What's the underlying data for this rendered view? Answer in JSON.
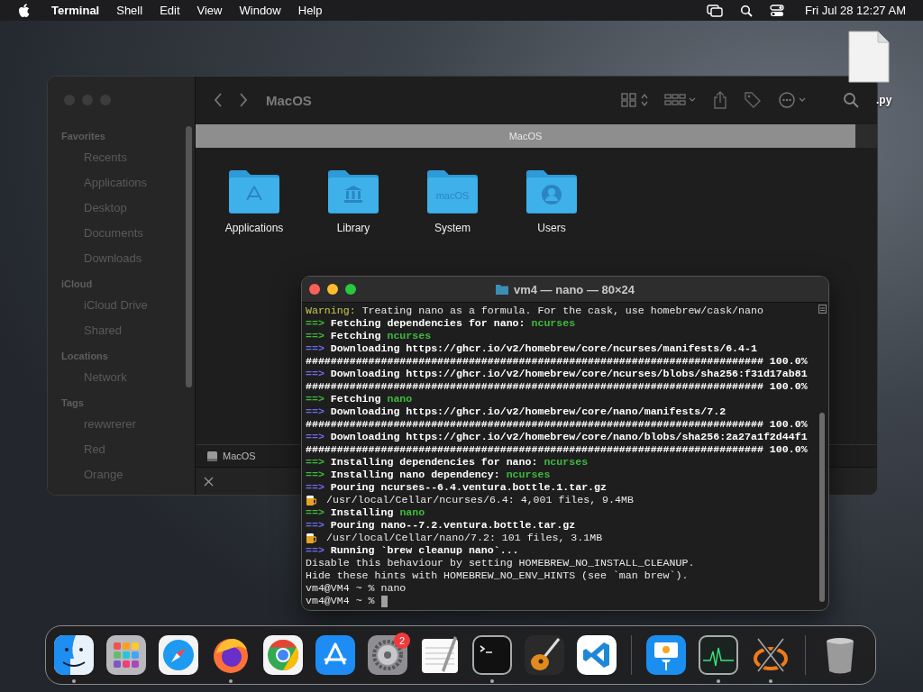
{
  "menu_bar": {
    "app": "Terminal",
    "menus": [
      "Shell",
      "Edit",
      "View",
      "Window",
      "Help"
    ],
    "clock": "Fri Jul 28  12:27 AM"
  },
  "desktop_file": {
    "label": ".py"
  },
  "finder": {
    "title": "MacOS",
    "path_tab": "MacOS",
    "sidebar": [
      {
        "heading": "Favorites",
        "items": [
          "Recents",
          "Applications",
          "Desktop",
          "Documents",
          "Downloads"
        ]
      },
      {
        "heading": "iCloud",
        "items": [
          "iCloud Drive",
          "Shared"
        ]
      },
      {
        "heading": "Locations",
        "items": [
          "Network"
        ]
      },
      {
        "heading": "Tags",
        "items": [
          "rewwrerer",
          "Red",
          "Orange"
        ]
      }
    ],
    "folders": [
      {
        "name": "Applications",
        "kind": "apps"
      },
      {
        "name": "Library",
        "kind": "library"
      },
      {
        "name": "System",
        "kind": "system",
        "mark": "macOS"
      },
      {
        "name": "Users",
        "kind": "users"
      }
    ],
    "path_bar": "MacOS"
  },
  "terminal": {
    "title": "vm4 — nano — 80×24",
    "lines": [
      {
        "kind": "text",
        "segments": [
          {
            "kind": "warning",
            "text": "Warning:"
          },
          {
            "kind": "output",
            "text": " Treating nano as a formula. For the cask, use homebrew/cask/nano"
          }
        ]
      },
      {
        "kind": "text",
        "segments": [
          {
            "kind": "arrow",
            "color": "#3dbb3d",
            "text": "==>"
          },
          {
            "kind": "command",
            "text": " Fetching dependencies for nano: "
          },
          {
            "kind": "package",
            "text": "ncurses"
          }
        ]
      },
      {
        "kind": "text",
        "segments": [
          {
            "kind": "arrow",
            "color": "#3dbb3d",
            "text": "==>"
          },
          {
            "kind": "command",
            "text": " Fetching "
          },
          {
            "kind": "package",
            "text": "ncurses"
          }
        ]
      },
      {
        "kind": "text",
        "segments": [
          {
            "kind": "arrow",
            "color": "#6d6df0",
            "text": "==>"
          },
          {
            "kind": "command",
            "text": " Downloading https://ghcr.io/v2/homebrew/core/ncurses/manifests/6.4-1"
          }
        ]
      },
      {
        "kind": "text",
        "segments": [
          {
            "kind": "command",
            "text": "######################################################################### 100.0%"
          }
        ]
      },
      {
        "kind": "text",
        "segments": [
          {
            "kind": "arrow",
            "color": "#6d6df0",
            "text": "==>"
          },
          {
            "kind": "command",
            "text": " Downloading https://ghcr.io/v2/homebrew/core/ncurses/blobs/sha256:f31d17ab81"
          }
        ]
      },
      {
        "kind": "text",
        "segments": [
          {
            "kind": "command",
            "text": "######################################################################### 100.0%"
          }
        ]
      },
      {
        "kind": "text",
        "segments": [
          {
            "kind": "arrow",
            "color": "#3dbb3d",
            "text": "==>"
          },
          {
            "kind": "command",
            "text": " Fetching "
          },
          {
            "kind": "package",
            "text": "nano"
          }
        ]
      },
      {
        "kind": "text",
        "segments": [
          {
            "kind": "arrow",
            "color": "#6d6df0",
            "text": "==>"
          },
          {
            "kind": "command",
            "text": " Downloading https://ghcr.io/v2/homebrew/core/nano/manifests/7.2"
          }
        ]
      },
      {
        "kind": "text",
        "segments": [
          {
            "kind": "command",
            "text": "######################################################################### 100.0%"
          }
        ]
      },
      {
        "kind": "text",
        "segments": [
          {
            "kind": "arrow",
            "color": "#6d6df0",
            "text": "==>"
          },
          {
            "kind": "command",
            "text": " Downloading https://ghcr.io/v2/homebrew/core/nano/blobs/sha256:2a27a1f2d44f1"
          }
        ]
      },
      {
        "kind": "text",
        "segments": [
          {
            "kind": "command",
            "text": "######################################################################### 100.0%"
          }
        ]
      },
      {
        "kind": "text",
        "segments": [
          {
            "kind": "arrow",
            "color": "#3dbb3d",
            "text": "==>"
          },
          {
            "kind": "command",
            "text": " Installing dependencies for nano: "
          },
          {
            "kind": "package",
            "text": "ncurses"
          }
        ]
      },
      {
        "kind": "text",
        "segments": [
          {
            "kind": "arrow",
            "color": "#3dbb3d",
            "text": "==>"
          },
          {
            "kind": "command",
            "text": " Installing nano dependency: "
          },
          {
            "kind": "package",
            "text": "ncurses"
          }
        ]
      },
      {
        "kind": "text",
        "segments": [
          {
            "kind": "arrow",
            "color": "#6d6df0",
            "text": "==>"
          },
          {
            "kind": "command",
            "text": " Pouring ncurses--6.4.ventura.bottle.1.tar.gz"
          }
        ]
      },
      {
        "kind": "beer",
        "segments": [
          {
            "kind": "output",
            "text": "/usr/local/Cellar/ncurses/6.4: 4,001 files, 9.4MB"
          }
        ]
      },
      {
        "kind": "text",
        "segments": [
          {
            "kind": "arrow",
            "color": "#3dbb3d",
            "text": "==>"
          },
          {
            "kind": "command",
            "text": " Installing "
          },
          {
            "kind": "package",
            "text": "nano"
          }
        ]
      },
      {
        "kind": "text",
        "segments": [
          {
            "kind": "arrow",
            "color": "#6d6df0",
            "text": "==>"
          },
          {
            "kind": "command",
            "text": " Pouring nano--7.2.ventura.bottle.tar.gz"
          }
        ]
      },
      {
        "kind": "beer",
        "segments": [
          {
            "kind": "output",
            "text": "/usr/local/Cellar/nano/7.2: 101 files, 3.1MB"
          }
        ]
      },
      {
        "kind": "text",
        "segments": [
          {
            "kind": "arrow",
            "color": "#6d6df0",
            "text": "==>"
          },
          {
            "kind": "command",
            "text": " Running `brew cleanup nano`..."
          }
        ]
      },
      {
        "kind": "text",
        "segments": [
          {
            "kind": "output",
            "text": "Disable this behaviour by setting HOMEBREW_NO_INSTALL_CLEANUP."
          }
        ]
      },
      {
        "kind": "text",
        "segments": [
          {
            "kind": "output",
            "text": "Hide these hints with HOMEBREW_NO_ENV_HINTS (see `man brew`)."
          }
        ]
      },
      {
        "kind": "text",
        "segments": [
          {
            "kind": "output",
            "text": "vm4@VM4 ~ % nano"
          }
        ]
      },
      {
        "kind": "prompt",
        "segments": [
          {
            "kind": "output",
            "text": "vm4@VM4 ~ %"
          }
        ]
      }
    ]
  },
  "dock": [
    {
      "kind": "finder",
      "running": true
    },
    {
      "kind": "launchpad",
      "running": false
    },
    {
      "kind": "safari",
      "running": false
    },
    {
      "kind": "firefox",
      "running": true
    },
    {
      "kind": "chrome",
      "running": false
    },
    {
      "kind": "appstore",
      "running": false
    },
    {
      "kind": "settings",
      "running": false,
      "badge": "2"
    },
    {
      "kind": "textedit",
      "running": false
    },
    {
      "kind": "terminal",
      "running": true
    },
    {
      "kind": "guitar",
      "running": false
    },
    {
      "kind": "vscode",
      "running": false
    },
    {
      "kind": "divider"
    },
    {
      "kind": "keynote",
      "running": false
    },
    {
      "kind": "monitor",
      "running": true
    },
    {
      "kind": "x11",
      "running": true
    },
    {
      "kind": "divider"
    },
    {
      "kind": "trash",
      "running": false
    }
  ]
}
